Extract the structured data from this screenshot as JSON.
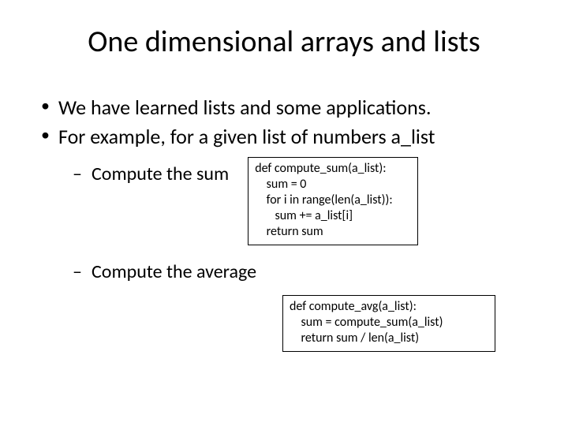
{
  "title": "One dimensional arrays and lists",
  "bullets": {
    "b1": "We have learned lists and some applications.",
    "b2": "For example, for a given list of numbers a_list",
    "sub1": "Compute the sum",
    "sub2": "Compute the average"
  },
  "code": {
    "sum": "def compute_sum(a_list):\n    sum = 0\n    for i in range(len(a_list)):\n       sum += a_list[i]\n    return sum",
    "avg": "def compute_avg(a_list):\n    sum = compute_sum(a_list)\n    return sum / len(a_list)"
  }
}
